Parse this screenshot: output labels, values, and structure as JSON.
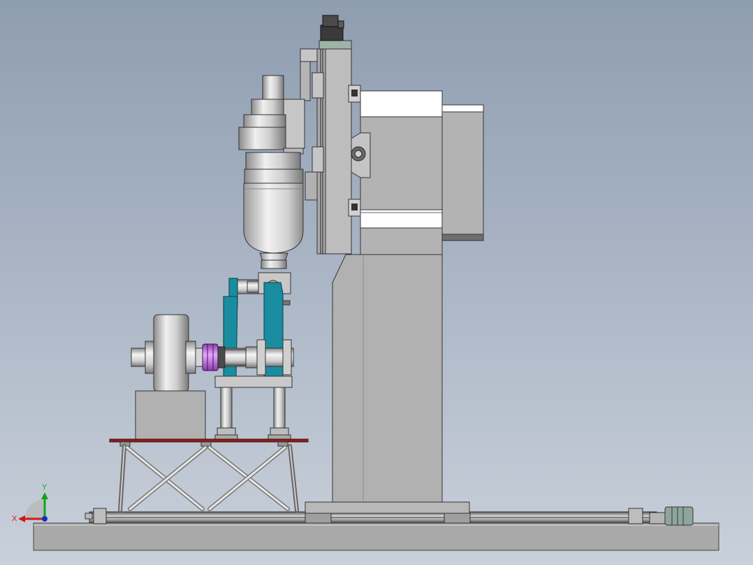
{
  "triad": {
    "x_label": "X",
    "y_label": "Y",
    "x_color": "#d01818",
    "y_color": "#16a020",
    "z_color": "#1a2fb8"
  },
  "colors": {
    "background_top": "#8f9db1",
    "background_bottom": "#c9d0da",
    "steel_light": "#c8c8c8",
    "steel_mid": "#a8a8a8",
    "steel_dark": "#6e6e6e",
    "bracket_teal": "#1a8ca0",
    "coupling_purple": "#b050d8",
    "platform_red": "#8a1d1d",
    "white_panel": "#ffffff"
  }
}
